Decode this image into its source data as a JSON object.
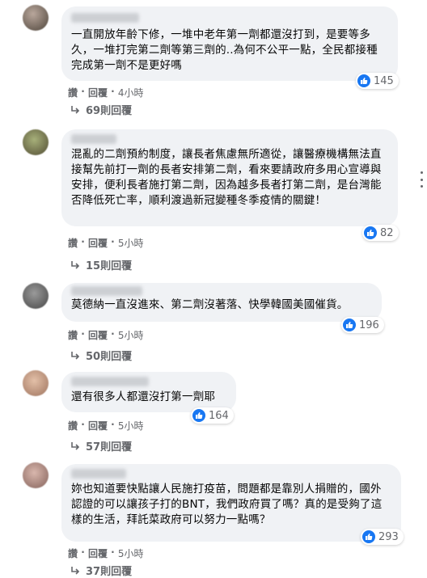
{
  "comments": [
    {
      "text": "一直開放年齡下修，一堆中老年第一劑都還沒打到，是要等多久，一堆打完第二劑等第三劑的..為何不公平一點，全民都接種完成第一劑不是更好嗎",
      "reactions": "145",
      "like": "讚",
      "reply": "回覆",
      "time": "4小時",
      "replies": "69則回覆"
    },
    {
      "text": "混亂的二劑預約制度，讓長者焦慮無所適從，讓醫療機構無法直接幫先前打一劑的長者安排第二劑，看來要請政府多用心宣導與安排，便利長者施打第二劑，因為越多長者打第二劑，是台灣能否降低死亡率，順利渡過新冠變種冬季疫情的關鍵！",
      "reactions": "82",
      "like": "讚",
      "reply": "回覆",
      "time": "5小時",
      "replies": "15則回覆"
    },
    {
      "text": "莫德納一直沒進來、第二劑沒著落、快學韓國美國催貨。",
      "reactions": "196",
      "like": "讚",
      "reply": "回覆",
      "time": "5小時",
      "replies": "50則回覆"
    },
    {
      "text": "還有很多人都還沒打第一劑耶",
      "reactions": "164",
      "like": "讚",
      "reply": "回覆",
      "time": "5小時",
      "replies": "57則回覆"
    },
    {
      "text": "妳也知道要快點讓人民施打疫苗，問題都是靠別人捐贈的，國外認證的可以讓孩子打的BNT，我們政府買了嗎？真的是受夠了這樣的生活，拜託菜政府可以努力一點嗎？",
      "reactions": "293",
      "like": "讚",
      "reply": "回覆",
      "time": "5小時",
      "replies": "37則回覆"
    }
  ],
  "separator": " · ",
  "colors": {
    "bubble": "#f0f2f5",
    "like_blue": "#1877f2",
    "meta": "#65676b"
  },
  "icons": {
    "reaction": "thumbs-up-icon",
    "replies": "reply-arrow-icon",
    "more": "more-options-icon"
  }
}
